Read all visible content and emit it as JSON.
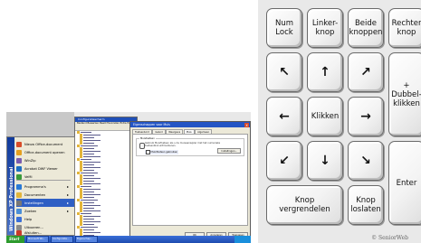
{
  "screenshot": {
    "start_menu": {
      "band_text": "Windows XP Professional",
      "items": [
        {
          "label": "Nieuw Office-document",
          "color": "#d84c2a"
        },
        {
          "label": "Office-document openen",
          "color": "#e6a020"
        },
        {
          "label": "WinZip",
          "color": "#7a5cb0"
        },
        {
          "label": "Acrobat DWF Viewer",
          "color": "#1d6fc2"
        },
        {
          "label": "VeMi",
          "color": "#3a9a3a"
        },
        {
          "label": "Programma's",
          "color": "#2a7ad6",
          "submenu": true
        },
        {
          "label": "Documenten",
          "color": "#e3b53a",
          "submenu": true
        },
        {
          "label": "Instellingen",
          "color": "#777777",
          "submenu": true,
          "selected": true
        },
        {
          "label": "Zoeken",
          "color": "#4a8ed8",
          "submenu": true
        },
        {
          "label": "Help",
          "color": "#3a6fd8"
        },
        {
          "label": "Uitvoeren...",
          "color": "#8a8a8a"
        },
        {
          "label": "Afsluiten...",
          "color": "#c83a2a"
        }
      ]
    },
    "explorer": {
      "title": "Configuratiescherm",
      "menu": "Bestand  Bewerken  Beeld  Favorieten  Extra  Help",
      "tree_rows": 40
    },
    "dialog": {
      "title": "Eigenschappen voor Muis",
      "close_label": "x",
      "tabs": [
        "Toetsenbord",
        "Geluid",
        "Weergave",
        "Muis",
        "Algemeen"
      ],
      "active_tab": "Muis",
      "group_label": "Muistoetsen",
      "description": "Gebruik MuisToetsen als u de muisaanwijzer met het numerieke toetsenblok wilt bedienen.",
      "checkbox_label": "MuisToetsen gebruiken",
      "settings_button": "Instellingen...",
      "buttons": [
        "OK",
        "Annuleren",
        "Toepassen"
      ]
    },
    "taskbar": {
      "start_label": "Start",
      "items": [
        "Microsoft Wo...",
        "Configuratie...",
        "Eigenschap..."
      ]
    }
  },
  "keypad": {
    "keys": [
      {
        "id": "num-lock",
        "label": "Num\nLock"
      },
      {
        "id": "linker-knop",
        "label": "Linker-\nknop"
      },
      {
        "id": "beide-knoppen",
        "label": "Beide\nknoppen"
      },
      {
        "id": "rechter-knop",
        "label": "Rechter\nknop"
      },
      {
        "id": "up-left",
        "label": "↖"
      },
      {
        "id": "up",
        "label": "↑"
      },
      {
        "id": "up-right",
        "label": "↗"
      },
      {
        "id": "plus",
        "label": "+\nDubbel-\nklikken"
      },
      {
        "id": "left",
        "label": "←"
      },
      {
        "id": "klikken",
        "label": "Klikken"
      },
      {
        "id": "right",
        "label": "→"
      },
      {
        "id": "down-left",
        "label": "↙"
      },
      {
        "id": "down",
        "label": "↓"
      },
      {
        "id": "down-right",
        "label": "↘"
      },
      {
        "id": "enter",
        "label": "Enter"
      },
      {
        "id": "knop-vergrendelen",
        "label": "Knop\nvergrendelen"
      },
      {
        "id": "knop-loslaten",
        "label": "Knop\nloslaten"
      }
    ],
    "credit": "© SeniorWeb"
  }
}
